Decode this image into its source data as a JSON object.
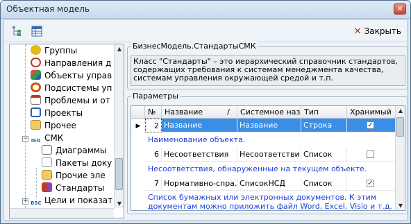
{
  "window": {
    "title": "Объектная модель"
  },
  "toolbar": {
    "close_label": "Закрыть"
  },
  "tree": {
    "items": [
      {
        "label": "Группы",
        "color": "#e8b818",
        "icon": "coins-icon"
      },
      {
        "label": "Направления д",
        "color": "#c0392b",
        "icon": "directions-icon"
      },
      {
        "label": "Объекты управ",
        "color": "#2e9b4a",
        "icon": "objects-icon"
      },
      {
        "label": "Подсистемы уп",
        "color": "#d35400",
        "icon": "subsystems-icon"
      },
      {
        "label": "Проблемы и от",
        "color": "#c0392b",
        "icon": "problems-icon"
      },
      {
        "label": "Проекты",
        "color": "#2a5ab8",
        "icon": "projects-icon"
      },
      {
        "label": "Прочее",
        "color": "#e0b040",
        "icon": "folder-icon"
      },
      {
        "label": "СМК",
        "color": "#1f5fb0",
        "icon": "iso-icon"
      },
      {
        "label": "Диаграммы",
        "color": "#5a6b7c",
        "icon": "diagram-icon"
      },
      {
        "label": "Пакеты доку",
        "color": "#8a9aac",
        "icon": "packages-icon"
      },
      {
        "label": "Прочие эле",
        "color": "#e0b040",
        "icon": "folder-icon"
      },
      {
        "label": "Стандарты",
        "color": "#c0392b",
        "icon": "standards-icon"
      },
      {
        "label": "Цели и показат",
        "color": "#1f5fb0",
        "icon": "bsc-icon"
      }
    ]
  },
  "description": {
    "group_title": "БизнесМодель.СтандартыСМК",
    "text": "Класс \"Стандарты\" – это иерархический справочник стандартов, содержащих требования к системам менеджмента качества, системам управления окружающей средой и т.п."
  },
  "params": {
    "group_title": "Параметры",
    "columns": [
      "№",
      "Название",
      "Системное наз...",
      "Тип",
      "Хранимый"
    ],
    "sort_mark": "/",
    "rows": [
      {
        "num": "2",
        "name": "Название",
        "sys": "Название",
        "type": "Строка",
        "stored": true,
        "desc": "Наименование объекта."
      },
      {
        "num": "6",
        "name": "Несоответствия",
        "sys": "Несоответстви...",
        "type": "Список",
        "stored": false,
        "desc": "Несоответствия, обнаруженные на текущем объекте."
      },
      {
        "num": "7",
        "name": "Нормативно-спра...",
        "sys": "СписокНСД",
        "type": "Список",
        "stored": true,
        "desc": "Список бумажных или электронных документов. К этим",
        "desc2": "документам можно приложить файл Word, Excel, Visio и т.д."
      }
    ]
  }
}
